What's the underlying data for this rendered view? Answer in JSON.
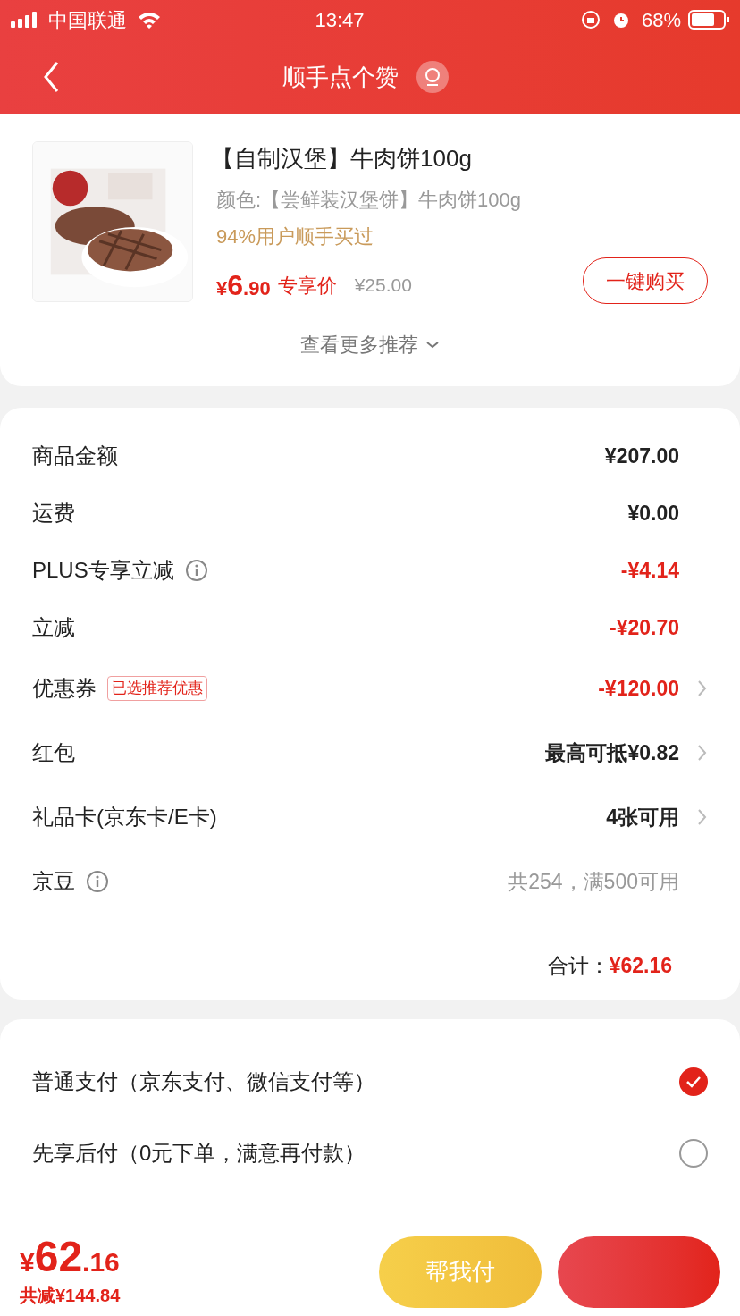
{
  "status_bar": {
    "carrier": "中国联通",
    "time": "13:47",
    "battery": "68%"
  },
  "header": {
    "title": "顺手点个赞"
  },
  "product": {
    "title": "【自制汉堡】牛肉饼100g",
    "variant": "颜色:【尝鲜装汉堡饼】牛肉饼100g",
    "popularity": "94%用户顺手买过",
    "price_symbol": "¥",
    "price_int": "6",
    "price_dec": ".90",
    "price_tag": "专享价",
    "original_price": "¥25.00",
    "buy_button": "一键购买",
    "more": "查看更多推荐"
  },
  "summary": {
    "rows": [
      {
        "label": "商品金额",
        "value": "¥207.00",
        "kind": "normal",
        "info": false,
        "chevron": false
      },
      {
        "label": "运费",
        "value": "¥0.00",
        "kind": "normal",
        "info": false,
        "chevron": false
      },
      {
        "label": "PLUS专享立减",
        "value": "-¥4.14",
        "kind": "discount",
        "info": true,
        "chevron": false
      },
      {
        "label": "立减",
        "value": "-¥20.70",
        "kind": "discount",
        "info": false,
        "chevron": false
      },
      {
        "label": "优惠券",
        "badge": "已选推荐优惠",
        "value": "-¥120.00",
        "kind": "discount",
        "info": false,
        "chevron": true
      },
      {
        "label": "红包",
        "value": "最高可抵¥0.82",
        "kind": "normal",
        "info": false,
        "chevron": true
      },
      {
        "label": "礼品卡(京东卡/E卡)",
        "value": "4张可用",
        "kind": "normal",
        "info": false,
        "chevron": true
      },
      {
        "label": "京豆",
        "value": "共254，满500可用",
        "kind": "muted",
        "info": true,
        "chevron": false
      }
    ],
    "total_label": "合计：",
    "total_value": "¥62.16"
  },
  "payment": [
    {
      "label": "普通支付（京东支付、微信支付等）",
      "selected": true
    },
    {
      "label": "先享后付（0元下单，满意再付款）",
      "selected": false
    }
  ],
  "bottom_bar": {
    "price_symbol": "¥",
    "price_int": "62",
    "price_dec": ".16",
    "saved": "共减¥144.84",
    "help_pay": "帮我付"
  }
}
